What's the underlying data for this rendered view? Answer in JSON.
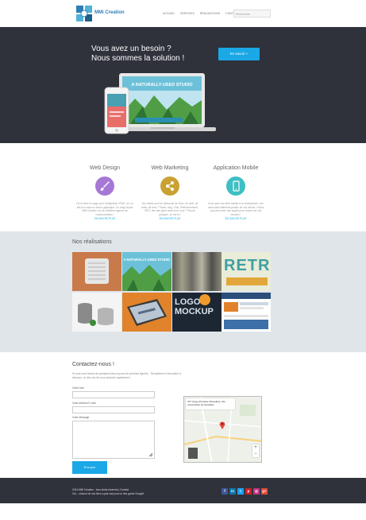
{
  "header": {
    "brand": "MMi Creation",
    "nav": [
      "ACCUEIL",
      "SERVICES",
      "RÉALISATIONS",
      "CONTACT"
    ],
    "search_placeholder": "Rechercher"
  },
  "hero": {
    "title_line1": "Vous avez un besoin ?",
    "title_line2": "Nous sommes la solution !",
    "cta_label": "En savoir +",
    "screen_banner": "A NATURALLY-USED STUDIO"
  },
  "services": [
    {
      "title": "Web Design",
      "desc": "De la mise en page pour l'intégration HTML, en un site leur mise en forme graphique. Ou rang l'esprit MMi Creation vos la meilleure agence de communication !",
      "link": "EN SAVOIR PLUS",
      "color": "#a678d6"
    },
    {
      "title": "Web Marketing",
      "desc": "Vos clients sont en demande de Buzz, de click, de tests, de fans ? Tweet, blog, Club, Référencement, SEO, rien des gens mais pour vous ? Pas de panique, on est là !",
      "link": "EN SAVOIR PLUS",
      "color": "#c9a233"
    },
    {
      "title": "Application Mobile",
      "desc": "Vous avez une idée mobile à un smartphone, une mise dans différents parties de vos clients ? Nous pouvons créer des applis pour chacun de vos besoins !",
      "link": "EN SAVOIR PLUS",
      "color": "#3dbfc4"
    }
  ],
  "realisations": {
    "title": "Nos réalisations",
    "tiles": [
      "RETR",
      "LOGO MOCKUP"
    ]
  },
  "contact": {
    "title": "Contactez-nous !",
    "intro": "Si vous avez besoin de quelques infos au jours de première lignées... Remplissez le formulaire ci-dessous, un des nos de vous répondre rapidement !",
    "name_label": "Votre Nom",
    "email_label": "Votre adresse E-mail",
    "message_label": "Votre Message",
    "send_label": "Envoyer",
    "map_card": "IUT Cergy-Pontoise (Sarcelles), site universitaire de Sarcelles"
  },
  "footer": {
    "line1": "2014 MMi Creation - tous droits réservés | Contact",
    "line2": "Oui... chacun de nos liens a pas mal pour un très grand Google!",
    "social": [
      "f",
      "in",
      "t",
      "p",
      "◎",
      "g+"
    ]
  }
}
